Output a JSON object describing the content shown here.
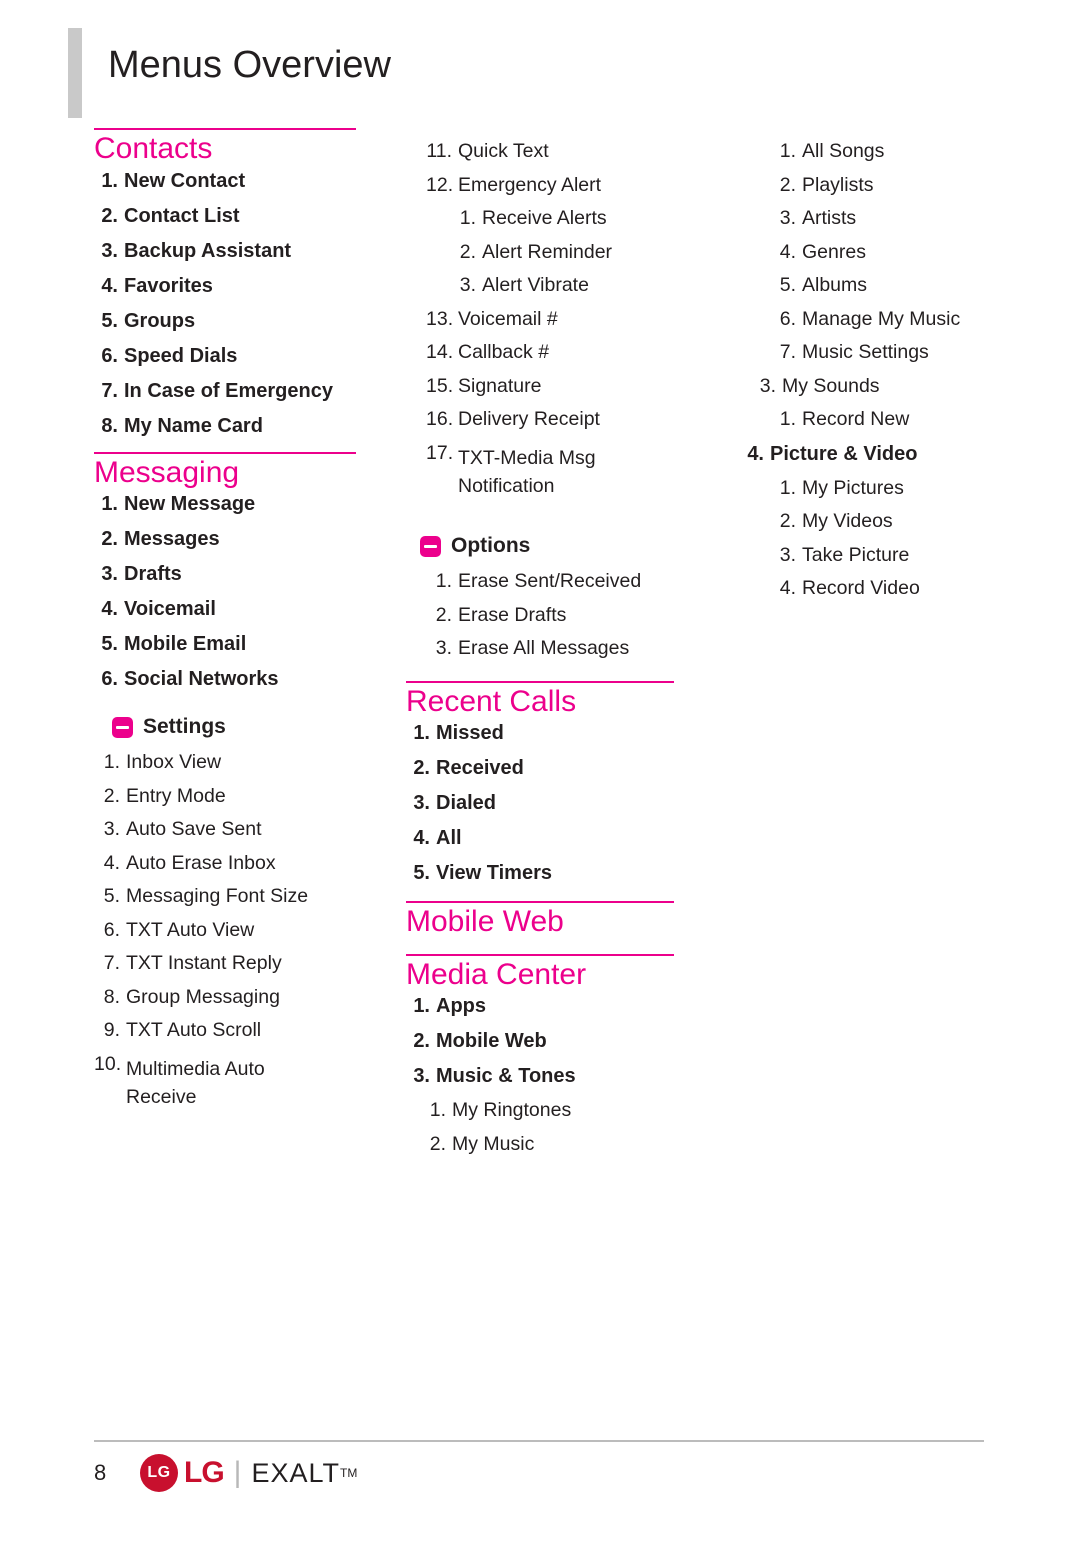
{
  "page": {
    "title": "Menus Overview",
    "number": "8",
    "brand": {
      "logo_mark": "LG",
      "logo_word": "LG",
      "divider": "|",
      "model": "EXALT",
      "trademark": "TM"
    }
  },
  "colors": {
    "accent": "#ec008c",
    "text": "#231f20",
    "rule": "#ec008c",
    "footer_rule": "#bcbcbc",
    "title_bar": "#c9c9c9",
    "logo_red": "#c8102e"
  },
  "columns": [
    {
      "sections": [
        {
          "heading": "Contacts",
          "items": [
            {
              "num": "1.",
              "text": "New Contact",
              "level": 1
            },
            {
              "num": "2.",
              "text": "Contact List",
              "level": 1
            },
            {
              "num": "3.",
              "text": "Backup Assistant",
              "level": 1
            },
            {
              "num": "4.",
              "text": "Favorites",
              "level": 1
            },
            {
              "num": "5.",
              "text": "Groups",
              "level": 1
            },
            {
              "num": "6.",
              "text": "Speed Dials",
              "level": 1
            },
            {
              "num": "7.",
              "text": "In Case of Emergency",
              "level": 1
            },
            {
              "num": "8.",
              "text": "My Name Card",
              "level": 1
            }
          ]
        },
        {
          "heading": "Messaging",
          "items": [
            {
              "num": "1.",
              "text": "New Message",
              "level": 1
            },
            {
              "num": "2.",
              "text": "Messages",
              "level": 1
            },
            {
              "num": "3.",
              "text": "Drafts",
              "level": 1
            },
            {
              "num": "4.",
              "text": "Voicemail",
              "level": 1
            },
            {
              "num": "5.",
              "text": "Mobile Email",
              "level": 1
            },
            {
              "num": "6.",
              "text": "Social Networks",
              "level": 1
            }
          ],
          "subhead": {
            "label": "Settings",
            "icon": "minus-box-icon",
            "items": [
              {
                "num": "1.",
                "text": "Inbox View",
                "level": 2
              },
              {
                "num": "2.",
                "text": "Entry Mode",
                "level": 2
              },
              {
                "num": "3.",
                "text": "Auto Save Sent",
                "level": 2
              },
              {
                "num": "4.",
                "text": "Auto Erase Inbox",
                "level": 2
              },
              {
                "num": "5.",
                "text": "Messaging Font Size",
                "level": 2
              },
              {
                "num": "6.",
                "text": "TXT Auto View",
                "level": 2
              },
              {
                "num": "7.",
                "text": "TXT Instant Reply",
                "level": 2
              },
              {
                "num": "8.",
                "text": "Group Messaging",
                "level": 2
              },
              {
                "num": "9.",
                "text": "TXT Auto Scroll",
                "level": 2
              },
              {
                "num": "10.",
                "text": "Multimedia Auto Receive",
                "level": 2
              }
            ]
          }
        }
      ]
    },
    {
      "continued_items": [
        {
          "num": "11.",
          "text": "Quick Text",
          "level": 2
        },
        {
          "num": "12.",
          "text": "Emergency Alert",
          "level": 2
        },
        {
          "num": "1.",
          "text": "Receive Alerts",
          "level": 3
        },
        {
          "num": "2.",
          "text": "Alert Reminder",
          "level": 3
        },
        {
          "num": "3.",
          "text": "Alert Vibrate",
          "level": 3
        },
        {
          "num": "13.",
          "text": "Voicemail #",
          "level": 2
        },
        {
          "num": "14.",
          "text": "Callback #",
          "level": 2
        },
        {
          "num": "15.",
          "text": "Signature",
          "level": 2
        },
        {
          "num": "16.",
          "text": "Delivery Receipt",
          "level": 2
        },
        {
          "num": "17.",
          "text": "TXT-Media Msg Notification",
          "level": 2
        }
      ],
      "options_subhead": {
        "label": "Options",
        "icon": "minus-box-icon",
        "items": [
          {
            "num": "1.",
            "text": "Erase Sent/Received",
            "level": 2
          },
          {
            "num": "2.",
            "text": "Erase Drafts",
            "level": 2
          },
          {
            "num": "3.",
            "text": "Erase All Messages",
            "level": 2
          }
        ]
      },
      "sections": [
        {
          "heading": "Recent Calls",
          "items": [
            {
              "num": "1.",
              "text": "Missed",
              "level": 1
            },
            {
              "num": "2.",
              "text": "Received",
              "level": 1
            },
            {
              "num": "3.",
              "text": "Dialed",
              "level": 1
            },
            {
              "num": "4.",
              "text": "All",
              "level": 1
            },
            {
              "num": "5.",
              "text": "View Timers",
              "level": 1
            }
          ]
        },
        {
          "heading": "Mobile Web",
          "items": []
        },
        {
          "heading": "Media Center",
          "items": [
            {
              "num": "1.",
              "text": "Apps",
              "level": 1
            },
            {
              "num": "2.",
              "text": "Mobile Web",
              "level": 1
            },
            {
              "num": "3.",
              "text": "Music & Tones",
              "level": 1
            },
            {
              "num": "1.",
              "text": "My Ringtones",
              "level": 2
            },
            {
              "num": "2.",
              "text": "My Music",
              "level": 2
            }
          ]
        }
      ]
    },
    {
      "continued_items": [
        {
          "num": "1.",
          "text": "All Songs",
          "level": 2
        },
        {
          "num": "2.",
          "text": "Playlists",
          "level": 2
        },
        {
          "num": "3.",
          "text": "Artists",
          "level": 2
        },
        {
          "num": "4.",
          "text": "Genres",
          "level": 2
        },
        {
          "num": "5.",
          "text": "Albums",
          "level": 2
        },
        {
          "num": "6.",
          "text": "Manage My Music",
          "level": 2
        },
        {
          "num": "7.",
          "text": "Music Settings",
          "level": 2
        },
        {
          "num": "3.",
          "text": "My Sounds",
          "level": 1.5
        },
        {
          "num": "1.",
          "text": "Record New",
          "level": 2
        }
      ],
      "picture_video": {
        "num": "4.",
        "text": "Picture & Video",
        "items": [
          {
            "num": "1.",
            "text": "My Pictures",
            "level": 2
          },
          {
            "num": "2.",
            "text": "My Videos",
            "level": 2
          },
          {
            "num": "3.",
            "text": "Take Picture",
            "level": 2
          },
          {
            "num": "4.",
            "text": "Record Video",
            "level": 2
          }
        ]
      }
    }
  ]
}
